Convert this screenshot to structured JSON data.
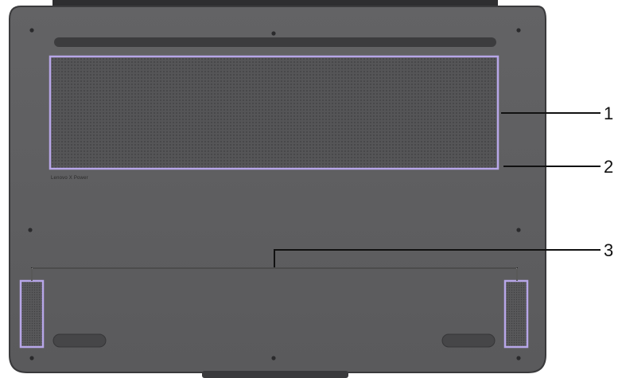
{
  "figure": {
    "brand_text": "Lenovo X Power",
    "callouts": [
      {
        "number": "1",
        "target": "bottom-vent-grille"
      },
      {
        "number": "2",
        "target": "vent-grille-edge"
      },
      {
        "number": "3",
        "target": "speakers"
      }
    ]
  },
  "colors": {
    "chassis": "#5c5c5e",
    "chassis_edge": "#3a3a3c",
    "highlight": "#b7a6e8",
    "leader_line": "#111111",
    "screw": "#2a2a2c",
    "foot": "#464648"
  }
}
